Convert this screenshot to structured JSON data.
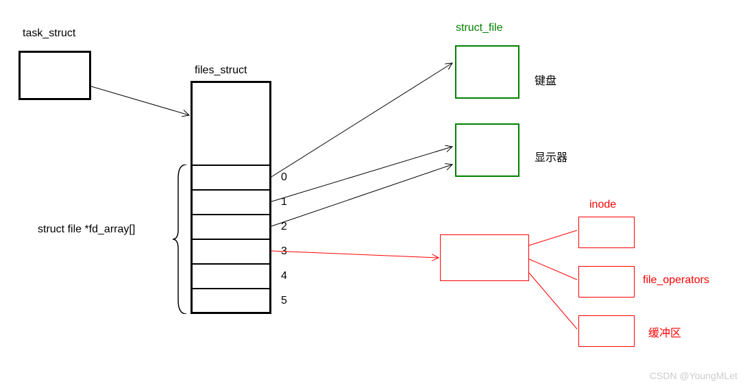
{
  "labels": {
    "task_struct": "task_struct",
    "files_struct": "files_struct",
    "fd_array": "struct file *fd_array[]",
    "struct_file": "struct_file",
    "keyboard": "键盘",
    "display": "显示器",
    "inode": "inode",
    "file_operators": "file_operators",
    "buffer": "缓冲区",
    "watermark": "CSDN @YoungMLet"
  },
  "indices": {
    "i0": "0",
    "i1": "1",
    "i2": "2",
    "i3": "3",
    "i4": "4",
    "i5": "5"
  }
}
